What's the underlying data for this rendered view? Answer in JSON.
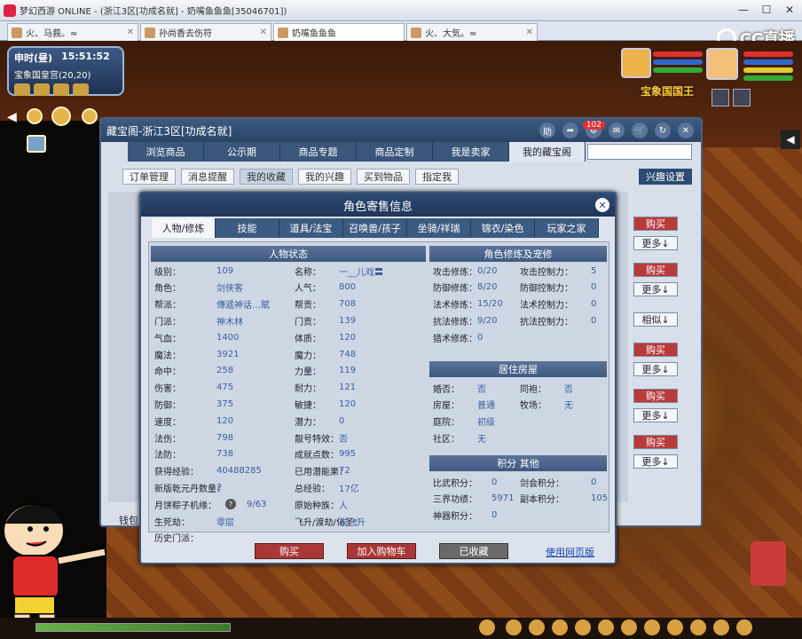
{
  "browser": {
    "title": "梦幻西游 ONLINE - (浙江3区[功成名就] - 奶嘴鱼鱼鱼[35046701])",
    "tabs": [
      "火、马莪。≈",
      "孙尚香去伤符",
      "奶嘴鱼鱼鱼",
      "火、大気。≈"
    ],
    "active_tab": 2,
    "cc_logo": "CC直播"
  },
  "hud": {
    "time_label": "申时(昼)",
    "clock": "15:51:52",
    "location": "宝象国皇宫(20,20)",
    "king_label": "宝象国国王"
  },
  "shop_window": {
    "title": "藏宝阁-浙江3区[功成名就]",
    "help_label": "助",
    "badge_count": "102",
    "tabs": [
      "浏览商品",
      "公示期",
      "商品专题",
      "商品定制",
      "我是卖家",
      "我的藏宝阁"
    ],
    "active_tab": 5,
    "subtabs": [
      "订单管理",
      "消息提醒",
      "我的收藏",
      "我的兴趣",
      "买到物品",
      "指定我"
    ],
    "active_subtab": 2,
    "interest_btn": "兴趣设置",
    "row_buttons": [
      {
        "label": "购买",
        "type": "buy"
      },
      {
        "label": "更多↓",
        "type": "more"
      },
      {
        "label": "购买",
        "type": "buy"
      },
      {
        "label": "更多↓",
        "type": "more"
      },
      {
        "label": "相似↓",
        "type": "more"
      },
      {
        "label": "购买",
        "type": "buy"
      },
      {
        "label": "更多↓",
        "type": "more"
      },
      {
        "label": "购买",
        "type": "buy"
      },
      {
        "label": "更多↓",
        "type": "more"
      },
      {
        "label": "购买",
        "type": "buy"
      },
      {
        "label": "更多↓",
        "type": "more"
      }
    ],
    "wallet_label": "钱包"
  },
  "dialog": {
    "title": "角色寄售信息",
    "tabs": [
      "人物/修炼",
      "技能",
      "道具/法宝",
      "召唤兽/孩子",
      "坐骑/祥瑞",
      "锦衣/染色",
      "玩家之家"
    ],
    "active_tab": 0,
    "section_status": "人物状态",
    "section_cultivation": "角色修炼及宠修",
    "section_house": "居住房屋",
    "section_points": "积分 其他",
    "col1": [
      {
        "k": "级别：",
        "v": "109"
      },
      {
        "k": "角色：",
        "v": "剑侠客"
      },
      {
        "k": "帮派：",
        "v": "傳遞神话…賦"
      },
      {
        "k": "门派：",
        "v": "神木林"
      },
      {
        "k": "气血：",
        "v": "1400"
      },
      {
        "k": "魔法：",
        "v": "3921"
      },
      {
        "k": "命中：",
        "v": "258"
      },
      {
        "k": "伤害：",
        "v": "475"
      },
      {
        "k": "防御：",
        "v": "375"
      },
      {
        "k": "速度：",
        "v": "120"
      },
      {
        "k": "法伤：",
        "v": "798"
      },
      {
        "k": "法防：",
        "v": "738"
      },
      {
        "k": "获得经验：",
        "v": "40488285"
      },
      {
        "k": "新版乾元丹数量：",
        "v": "2"
      },
      {
        "k": "月饼粽子机缘：",
        "v": "9/63"
      },
      {
        "k": "生死劫：",
        "v": "零层"
      },
      {
        "k": "历史门派：",
        "v": ""
      }
    ],
    "col2": [
      {
        "k": "名称：",
        "v": "一__儿戏〓"
      },
      {
        "k": "人气：",
        "v": "800"
      },
      {
        "k": "帮贡：",
        "v": "708"
      },
      {
        "k": "门贡：",
        "v": "139"
      },
      {
        "k": "体质：",
        "v": "120"
      },
      {
        "k": "魔力：",
        "v": "748"
      },
      {
        "k": "力量：",
        "v": "119"
      },
      {
        "k": "耐力：",
        "v": "121"
      },
      {
        "k": "敏捷：",
        "v": "120"
      },
      {
        "k": "潜力：",
        "v": "0"
      },
      {
        "k": "靓号特效：",
        "v": "否"
      },
      {
        "k": "成就点数：",
        "v": "995"
      },
      {
        "k": "已用潜能果：",
        "v": "72"
      },
      {
        "k": "总经验：",
        "v": "17亿"
      },
      {
        "k": "原始种族：",
        "v": "人"
      },
      {
        "k": "飞升/渡劫/化圣：",
        "v": "未飞升"
      }
    ],
    "cult_left": [
      {
        "k": "攻击修炼：",
        "v": "0/20"
      },
      {
        "k": "防御修炼：",
        "v": "8/20"
      },
      {
        "k": "法术修炼：",
        "v": "15/20"
      },
      {
        "k": "抗法修炼：",
        "v": "9/20"
      },
      {
        "k": "猎术修炼：",
        "v": "0"
      }
    ],
    "cult_right": [
      {
        "k": "攻击控制力：",
        "v": "5"
      },
      {
        "k": "防御控制力：",
        "v": "0"
      },
      {
        "k": "法术控制力：",
        "v": "0"
      },
      {
        "k": "抗法控制力：",
        "v": "0"
      }
    ],
    "house_left": [
      {
        "k": "婚否：",
        "v": "否"
      },
      {
        "k": "房屋：",
        "v": "普通"
      },
      {
        "k": "庭院：",
        "v": "初级"
      },
      {
        "k": "社区：",
        "v": "无"
      }
    ],
    "house_right": [
      {
        "k": "同袍：",
        "v": "否"
      },
      {
        "k": "牧场：",
        "v": "无"
      }
    ],
    "points_left": [
      {
        "k": "比武积分：",
        "v": "0"
      },
      {
        "k": "三界功绩：",
        "v": "5971"
      },
      {
        "k": "神器积分：",
        "v": "0"
      }
    ],
    "points_right": [
      {
        "k": "剑会积分：",
        "v": "0"
      },
      {
        "k": "副本积分：",
        "v": "105"
      }
    ],
    "btn_buy": "购买",
    "btn_cart": "加入购物车",
    "btn_collected": "已收藏",
    "link_web": "使用网页版",
    "question_mark": "?"
  }
}
